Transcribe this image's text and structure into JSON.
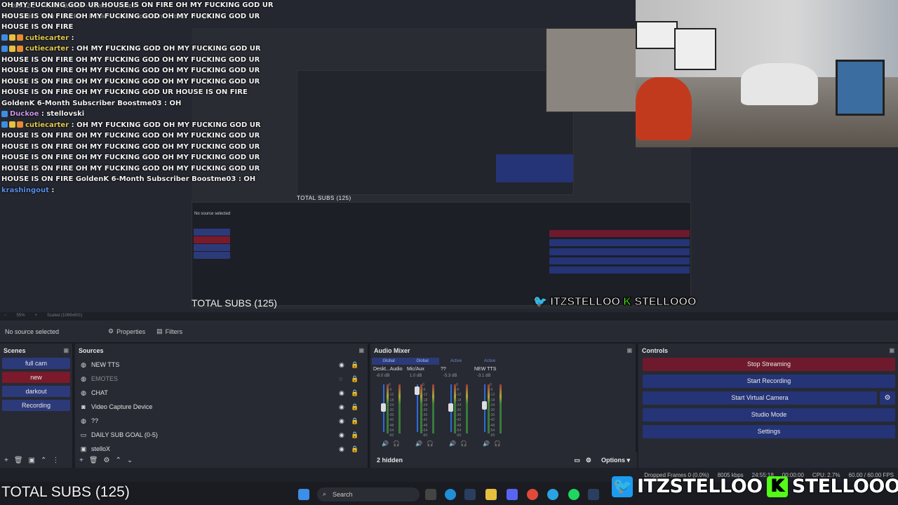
{
  "window_title": "Obs 32.2 - Profile: Untitled - Scenes: Untitled",
  "menu": [
    "File",
    "Edit",
    "View",
    "Docks",
    "Profile",
    "Scene Collection",
    "Tools",
    "Help"
  ],
  "chat": [
    {
      "user": "",
      "text": "OH MY FUCKING GOD UR HOUSE IS ON FIRE OH MY FUCKING GOD UR HOUSE IS ON FIRE OH MY FUCKING GOD OH MY FUCKING GOD UR HOUSE IS ON FIRE",
      "badges": 0,
      "color": "#e2c94e"
    },
    {
      "user": "cutiecarter",
      "text": "",
      "badges": 3,
      "color": "#e2c94e"
    },
    {
      "user": "cutiecarter",
      "text": "OH MY FUCKING GOD OH MY FUCKING GOD UR HOUSE IS ON FIRE OH MY FUCKING GOD OH MY FUCKING GOD UR HOUSE IS ON FIRE OH MY FUCKING GOD OH MY FUCKING GOD UR HOUSE IS ON FIRE OH MY FUCKING GOD OH MY FUCKING GOD UR HOUSE IS ON FIRE OH MY FUCKING GOD UR HOUSE IS ON FIRE GoldenK 6-Month Subscriber Boostme03 : OH",
      "badges": 3,
      "color": "#e2c94e"
    },
    {
      "user": "Duckoe",
      "text": "stellovski",
      "badges": 1,
      "color": "#c896e8"
    },
    {
      "user": "cutiecarter",
      "text": "OH MY FUCKING GOD OH MY FUCKING GOD UR HOUSE IS ON FIRE OH MY FUCKING GOD OH MY FUCKING GOD UR HOUSE IS ON FIRE OH MY FUCKING GOD OH MY FUCKING GOD UR HOUSE IS ON FIRE OH MY FUCKING GOD OH MY FUCKING GOD UR HOUSE IS ON FIRE OH MY FUCKING GOD OH MY FUCKING GOD UR HOUSE IS ON FIRE GoldenK 6-Month Subscriber Boostme03 : OH",
      "badges": 3,
      "color": "#e2c94e"
    },
    {
      "user": "krashingout",
      "text": "",
      "badges": 0,
      "color": "#5b8fe8"
    }
  ],
  "preview": {
    "zoom": "55%",
    "scaled": "Scaled (1069x601)",
    "total_subs": "TOTAL SUBS (125)",
    "brand": "ITZSTELLOO",
    "brand2": "STELLOOO"
  },
  "context_bar": {
    "no_source": "No source selected",
    "properties": "Properties",
    "filters": "Filters"
  },
  "scenes": {
    "title": "Scenes",
    "items": [
      {
        "label": "full cam",
        "active": false
      },
      {
        "label": "new",
        "active": true
      },
      {
        "label": "darkout",
        "active": false
      },
      {
        "label": "Recording",
        "active": false
      }
    ]
  },
  "sources": {
    "title": "Sources",
    "items": [
      {
        "label": "NEW TTS",
        "icon": "globe-icon",
        "dim": false
      },
      {
        "label": "EMOTES",
        "icon": "globe-icon",
        "dim": true
      },
      {
        "label": "CHAT",
        "icon": "globe-icon",
        "dim": false
      },
      {
        "label": "Video Capture Device",
        "icon": "camera-icon",
        "dim": false
      },
      {
        "label": "??",
        "icon": "globe-icon",
        "dim": false
      },
      {
        "label": "DAILY SUB GOAL (0-5)",
        "icon": "window-icon",
        "dim": false
      },
      {
        "label": "stelloX",
        "icon": "image-icon",
        "dim": false
      }
    ]
  },
  "mixer": {
    "title": "Audio Mixer",
    "headers": [
      "Global",
      "Global",
      "Active",
      "Active"
    ],
    "channels": [
      {
        "name": "Deskt...Audio",
        "db": "-8.0 dB",
        "level": 0.55
      },
      {
        "name": "Mic/Aux",
        "db": "1.0 dB",
        "level": 0.95
      },
      {
        "name": "??",
        "db": "-5.3 dB",
        "level": 0.55
      },
      {
        "name": "NEW TTS",
        "db": "-3.1 dB",
        "level": 0.6
      }
    ],
    "scale": [
      "0",
      "-6",
      "-12",
      "-18",
      "-24",
      "-30",
      "-36",
      "-42",
      "-48",
      "-54",
      "-60"
    ],
    "hidden": "2 hidden",
    "options": "Options"
  },
  "controls": {
    "title": "Controls",
    "buttons": [
      "Stop Streaming",
      "Start Recording",
      "Start Virtual Camera",
      "Studio Mode",
      "Settings"
    ]
  },
  "status": {
    "dropped": "Dropped Frames 0 (0.0%)",
    "kbps": "8005 kbps",
    "live": "24:55:18",
    "rec": "00:00:00",
    "cpu": "CPU: 2.7%",
    "fps": "60.00 / 60.00 FPS"
  },
  "taskbar": {
    "search": "Search",
    "total_subs": "TOTAL SUBS (125)"
  },
  "colors": {
    "accent_blue": "#253477",
    "stop_red": "#6e1a2c",
    "active_scene": "#7a1a2a"
  }
}
